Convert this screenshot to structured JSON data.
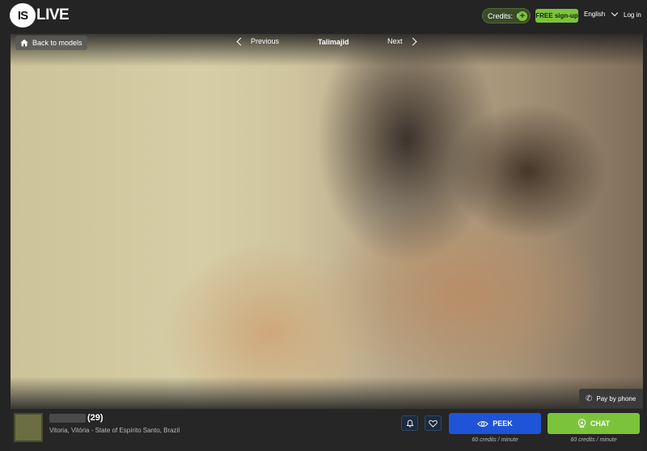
{
  "header": {
    "logo_left": "IS",
    "logo_right": "LIVE",
    "credits_label": "Credits:",
    "credits_value": "0",
    "signup_label": "FREE sign-up",
    "language": "English",
    "login_label": "Log in"
  },
  "nav": {
    "back_label": "Back to models",
    "previous_label": "Previous",
    "model_name": "Talimajid",
    "next_label": "Next"
  },
  "pay_by_phone": "Pay by phone",
  "profile": {
    "age": "(29)",
    "location": "Vitoria, Vitória - State of Espírito Santo, Brazil"
  },
  "actions": {
    "peek_label": "PEEK",
    "peek_price": "60 credits / minute",
    "chat_label": "CHAT",
    "chat_price": "60 credits / minute"
  },
  "colors": {
    "accent_green": "#7cc33c",
    "peek_blue": "#1f54d8",
    "background": "#242424"
  }
}
